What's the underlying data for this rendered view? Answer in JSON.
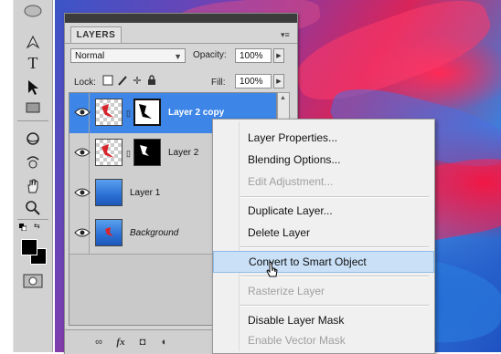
{
  "tools": [
    {
      "icon": "pen-tool-icon",
      "glyph": "✒"
    },
    {
      "icon": "type-tool-icon",
      "glyph": "T"
    },
    {
      "icon": "path-selection-icon",
      "glyph": "▸"
    },
    {
      "icon": "rectangle-shape-icon",
      "glyph": "▭"
    },
    {
      "icon": "3d-rotate-icon",
      "glyph": "◎"
    },
    {
      "icon": "3d-orbit-icon",
      "glyph": "◌"
    },
    {
      "icon": "hand-tool-icon",
      "glyph": "✋"
    },
    {
      "icon": "zoom-tool-icon",
      "glyph": "⚲"
    }
  ],
  "colors": {
    "foreground": "#000000",
    "background": "#000000",
    "selection": "#3d86e8",
    "menu_hover": "#c9e0f7"
  },
  "panel": {
    "tab_label": "LAYERS",
    "blend_mode": "Normal",
    "opacity_label": "Opacity:",
    "opacity_value": "100%",
    "lock_label": "Lock:",
    "fill_label": "Fill:",
    "fill_value": "100%"
  },
  "layers": [
    {
      "name": "Layer 2 copy",
      "selected": true,
      "mask": "white"
    },
    {
      "name": "Layer 2",
      "selected": false,
      "mask": "black"
    },
    {
      "name": "Layer 1",
      "selected": false
    },
    {
      "name": "Background",
      "selected": false
    }
  ],
  "footer_icons": [
    "link-layers-icon",
    "fx-icon",
    "add-mask-icon",
    "adjustment-layer-icon"
  ],
  "footer_glyphs": {
    "link": "∞",
    "fx": "fx",
    "mask": "◘",
    "adjust": "◐"
  },
  "context_menu": {
    "items": [
      {
        "label": "Layer Properties...",
        "enabled": true
      },
      {
        "label": "Blending Options...",
        "enabled": true
      },
      {
        "label": "Edit Adjustment...",
        "enabled": false
      },
      {
        "label": "Duplicate Layer...",
        "enabled": true
      },
      {
        "label": "Delete Layer",
        "enabled": true
      },
      {
        "label": "Convert to Smart Object",
        "enabled": true,
        "hover": true
      },
      {
        "label": "Rasterize Layer",
        "enabled": false
      },
      {
        "label": "Disable Layer Mask",
        "enabled": true
      },
      {
        "label": "Enable Vector Mask",
        "enabled": false
      }
    ]
  }
}
